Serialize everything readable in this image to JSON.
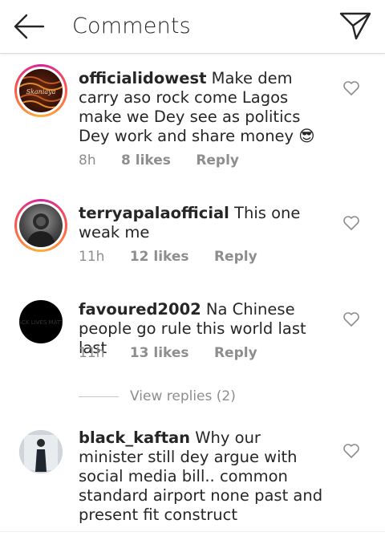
{
  "header": {
    "title": "Comments",
    "back_icon": "arrow-left-icon",
    "send_icon": "paper-plane-icon"
  },
  "comments": [
    {
      "username": "officialidowest",
      "text": "Make dem carry aso rock come Lagos make we Dey see as politics Dey work and share money 😎",
      "time": "8h",
      "likes": "8 likes",
      "reply": "Reply",
      "has_story_ring": true,
      "avatar_label": "Skaniaya"
    },
    {
      "username": "terryapalaofficial",
      "text": "This one weak me",
      "time": "11h",
      "likes": "12 likes",
      "reply": "Reply",
      "has_story_ring": true
    },
    {
      "username": "favoured2002",
      "text": "Na Chinese people go rule this world last last",
      "time": "11h",
      "likes": "13 likes",
      "reply": "Reply",
      "has_story_ring": false,
      "avatar_label": "BLACK LIVES MATTER"
    },
    {
      "username": "black_kaftan",
      "text": "Why our minister still dey argue with social media bill.. common standard airport none past and present fit construct",
      "has_story_ring": false
    }
  ],
  "view_replies": "View replies (2)",
  "colors": {
    "accent_ring": "#d6249f",
    "muted_text": "#8e8e8e",
    "text": "#262626"
  }
}
